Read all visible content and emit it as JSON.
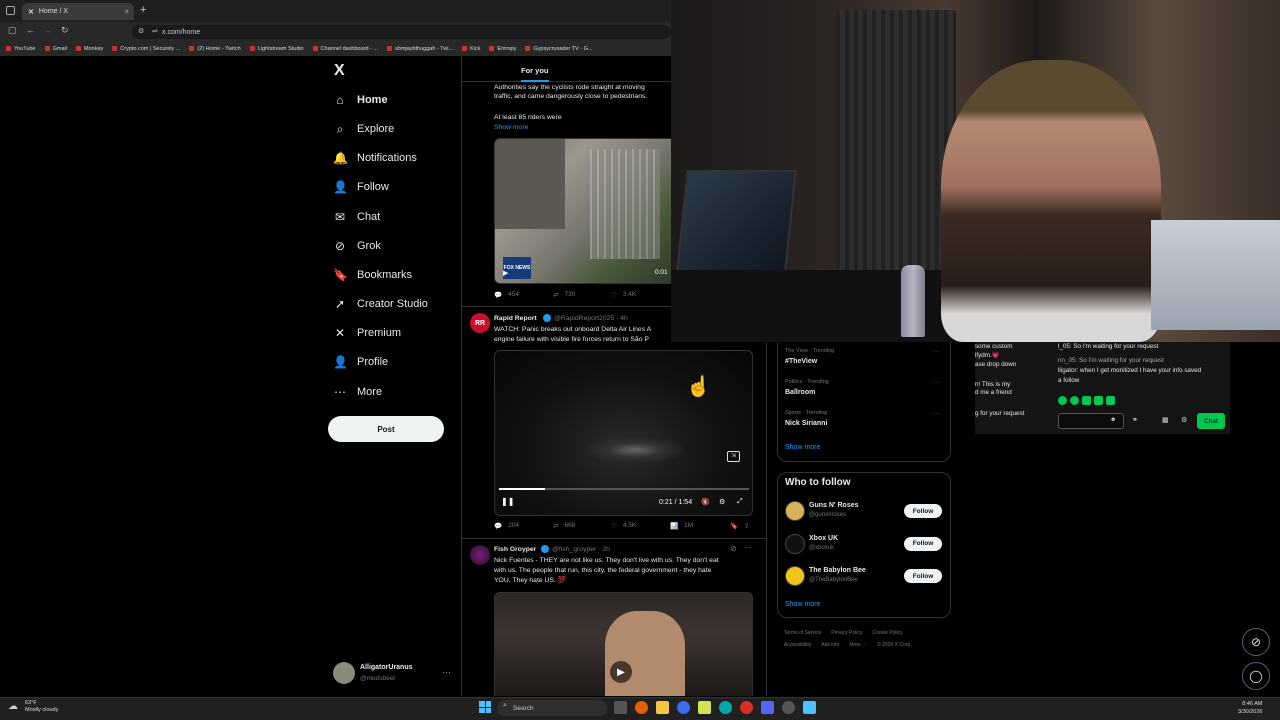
{
  "browser": {
    "tab_title": "Home / X",
    "tab_close": "×",
    "new_tab": "+",
    "url": "x.com/home",
    "bookmarks": [
      "YouTube",
      "Gmail",
      "Monkey",
      "Crypto.com | Securely ...",
      "(2) Home - Twitch",
      "Lightstream Studio",
      "Channel dashboard - ...",
      "sbmjaybthuggah - Twi...",
      "Kick",
      "Entropy",
      "Gypsycrusader TV - G..."
    ]
  },
  "sidebar": {
    "logo": "X",
    "items": [
      {
        "label": "Home",
        "icon": "home-icon",
        "glyph": "⌂"
      },
      {
        "label": "Explore",
        "icon": "search-icon",
        "glyph": "⌕"
      },
      {
        "label": "Notifications",
        "icon": "bell-icon",
        "glyph": "🔔"
      },
      {
        "label": "Follow",
        "icon": "person-plus-icon",
        "glyph": "👤"
      },
      {
        "label": "Chat",
        "icon": "mail-icon",
        "glyph": "✉"
      },
      {
        "label": "Grok",
        "icon": "grok-icon",
        "glyph": "⊘"
      },
      {
        "label": "Bookmarks",
        "icon": "bookmark-icon",
        "glyph": "🔖"
      },
      {
        "label": "Creator Studio",
        "icon": "creator-studio-icon",
        "glyph": "➚"
      },
      {
        "label": "Premium",
        "icon": "x-premium-icon",
        "glyph": "✕"
      },
      {
        "label": "Profile",
        "icon": "profile-icon",
        "glyph": "👤"
      },
      {
        "label": "More",
        "icon": "more-circle-icon",
        "glyph": "⋯"
      }
    ],
    "post_label": "Post",
    "account": {
      "name": "AlligatorUranus",
      "handle": "@mudsbeer",
      "more": "···"
    }
  },
  "feed": {
    "tab_label": "For you",
    "tweet1": {
      "text_a": "Authorities say the cyclists rode straight at moving",
      "text_b": "traffic, and came dangerously close to pedestrians.",
      "text_c": "At least 85 riders were",
      "show_more": "Show more",
      "video_time": "0:01",
      "video_badge": "FOX NEWS",
      "replies": "454",
      "reposts": "730",
      "likes": "3.4K"
    },
    "tweet2": {
      "name": "Rapid Report",
      "handle": "@RapidReport2025 · 4h",
      "avatar_text": "RR",
      "text_a": "WATCH: Panic breaks out onboard Delta Air Lines A",
      "text_b": "engine failure with visible fire forces return to São P",
      "video_time": "0:21 / 1:54",
      "replies": "204",
      "reposts": "668",
      "likes": "4.5K",
      "views": "1M"
    },
    "tweet3": {
      "name": "Fish Groyper",
      "handle": "@fish_groyper · 2h",
      "text_a": "Nick Fuentes - THEY are not like us. They don't live with us. They don't eat",
      "text_b": "with us. The people that run, this city, the federal government - they hate",
      "text_c": "YOU. They hate US. 💯"
    }
  },
  "trends": [
    {
      "meta": "The View · Trending",
      "name": "#TheView"
    },
    {
      "meta": "Politics · Trending",
      "name": "Ballroom"
    },
    {
      "meta": "Sports · Trending",
      "name": "Nick Sirianni"
    }
  ],
  "trends_show_more": "Show more",
  "who_to_follow": {
    "title": "Who to follow",
    "accounts": [
      {
        "name": "Guns N' Roses",
        "handle": "@gunsnroses",
        "button": "Follow"
      },
      {
        "name": "Xbox UK",
        "handle": "@xboxuk",
        "button": "Follow"
      },
      {
        "name": "The Babylon Bee",
        "handle": "@TheBabylonBee",
        "button": "Follow"
      }
    ],
    "show_more": "Show more"
  },
  "footer": {
    "line1": [
      "Terms of Service",
      "Privacy Policy",
      "Cookie Policy"
    ],
    "line2": [
      "Accessibility",
      "Ads info",
      "More ···",
      "© 2026 X Corp."
    ]
  },
  "stream_chat": {
    "left_lines": [
      "some custom",
      "lfydm.💗",
      "ase drop down",
      "n! This is my",
      "d me a friend",
      "g for your request"
    ],
    "right_lines": [
      "l_05: So I'm waiting for your request",
      "nn_05: So I'm waiting for your request",
      "lligator: when I get monitized I have your info saved",
      "a follow"
    ],
    "chat_button": "Chat"
  },
  "taskbar": {
    "search": "Search",
    "weather_temp": "63°F",
    "weather_desc": "Mostly cloudy",
    "time": "8:46 AM",
    "date": "3/30/2026"
  },
  "colors": {
    "accent": "#1d9bf0",
    "chat_green": "#00c853",
    "bg": "#000000"
  }
}
